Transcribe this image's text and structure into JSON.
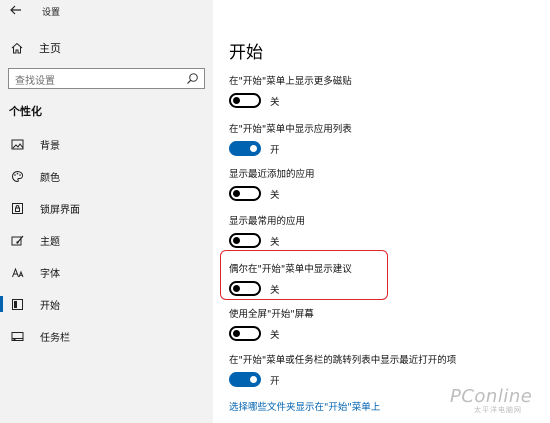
{
  "window": {
    "title": "设置"
  },
  "sidebar": {
    "home_label": "主页",
    "search_placeholder": "查找设置",
    "section_heading": "个性化",
    "items": [
      {
        "label": "背景",
        "icon": "picture-icon"
      },
      {
        "label": "颜色",
        "icon": "palette-icon"
      },
      {
        "label": "锁屏界面",
        "icon": "lock-screen-icon"
      },
      {
        "label": "主题",
        "icon": "theme-icon"
      },
      {
        "label": "字体",
        "icon": "font-icon"
      },
      {
        "label": "开始",
        "icon": "start-icon",
        "active": true
      },
      {
        "label": "任务栏",
        "icon": "taskbar-icon"
      }
    ]
  },
  "main": {
    "title": "开始",
    "settings": [
      {
        "label": "在\"开始\"菜单上显示更多磁贴",
        "state": "关",
        "on": false
      },
      {
        "label": "在\"开始\"菜单中显示应用列表",
        "state": "开",
        "on": true
      },
      {
        "label": "显示最近添加的应用",
        "state": "关",
        "on": false
      },
      {
        "label": "显示最常用的应用",
        "state": "关",
        "on": false
      },
      {
        "label": "偶尔在\"开始\"菜单中显示建议",
        "state": "关",
        "on": false
      },
      {
        "label": "使用全屏\"开始\"屏幕",
        "state": "关",
        "on": false
      },
      {
        "label": "在\"开始\"菜单或任务栏的跳转列表中显示最近打开的项",
        "state": "开",
        "on": true
      }
    ],
    "link": "选择哪些文件夹显示在\"开始\"菜单上"
  },
  "watermark": {
    "main": "PConline",
    "sub": "太平洋电脑网"
  },
  "colors": {
    "accent": "#0063b1",
    "highlight": "#e0262c",
    "sidebar_bg": "#f2f2f2"
  }
}
